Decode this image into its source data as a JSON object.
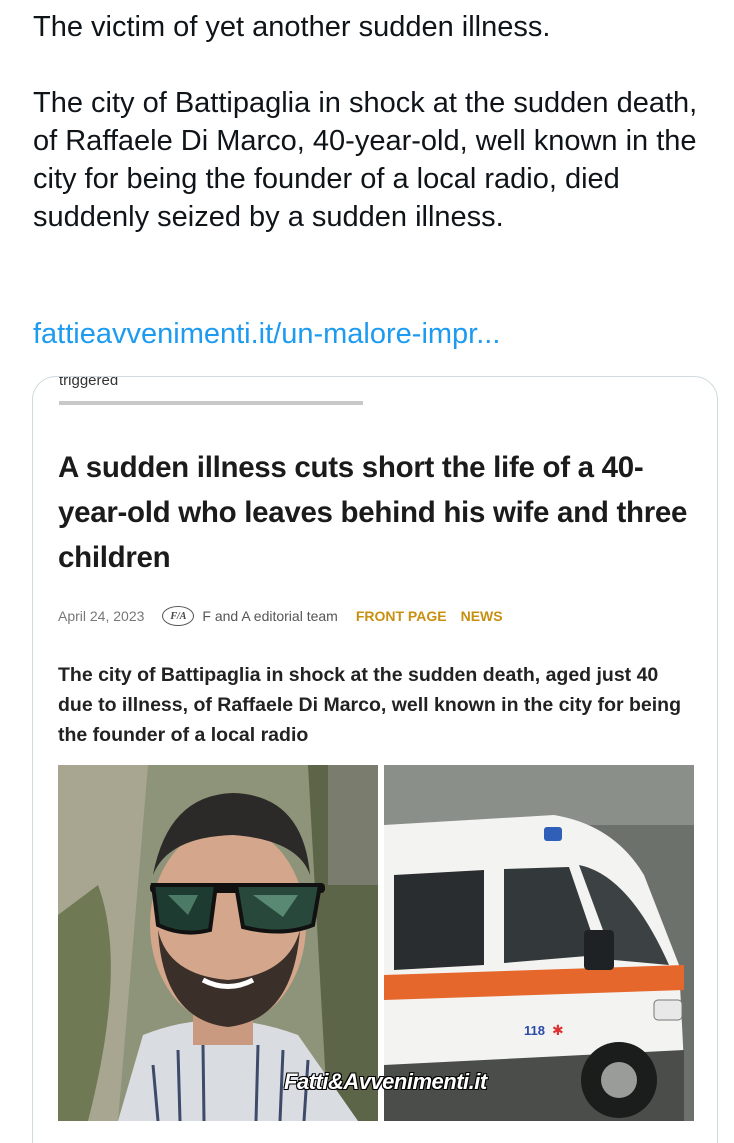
{
  "tweet": {
    "line1": "The victim of yet another sudden illness.",
    "paragraph": "The city of Battipaglia in shock at the sudden death, of Raffaele Di Marco, 40-year-old, well known in the city for being the founder of a local radio, died suddenly seized by a sudden illness.",
    "link": "fattieavvenimenti.it/un-malore-impr..."
  },
  "card": {
    "triggered": "triggered",
    "headline": "A sudden illness cuts short the life of a 40-year-old who leaves behind his wife and three children",
    "date": "April 24, 2023",
    "logo_text": "F/A",
    "author": "F and A editorial team",
    "categories": [
      "FRONT PAGE",
      "NEWS"
    ],
    "lede": "The city of Battipaglia in shock at the sudden death, aged just 40 due to illness,  of Raffaele Di Marco, well known in the city for being the founder of a local radio",
    "watermark": "Fatti&Avvenimenti.it",
    "ambulance_number": "118"
  },
  "colors": {
    "link": "#1d9bf0",
    "category": "#c79010",
    "text": "#0f1419"
  }
}
